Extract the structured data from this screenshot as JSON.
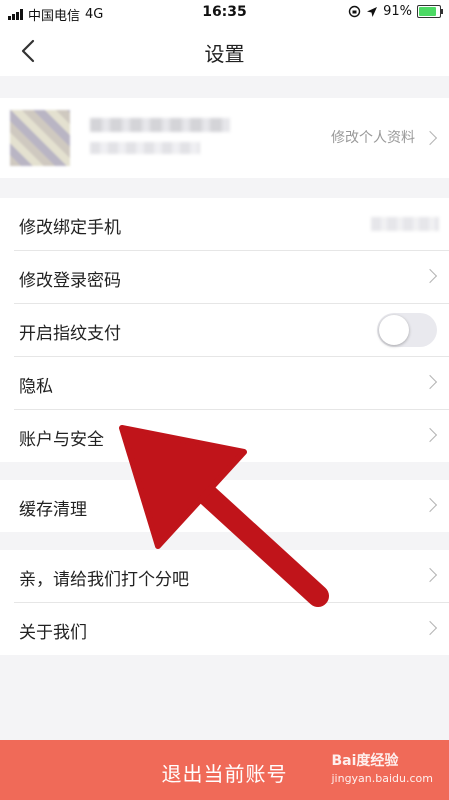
{
  "status_bar": {
    "carrier": "中国电信",
    "network": "4G",
    "time": "16:35",
    "battery": "91%",
    "battery_level": 0.91,
    "colors": {
      "battery_fill": "#4cd964"
    }
  },
  "nav": {
    "title": "设置",
    "back_icon": "chevron-left-icon"
  },
  "profile": {
    "edit_label": "修改个人资料",
    "chevron_icon": "chevron-right-icon"
  },
  "groups": [
    {
      "items": [
        {
          "label": "修改绑定手机",
          "accessory": "blurred-value"
        },
        {
          "label": "修改登录密码",
          "accessory": "chevron"
        },
        {
          "label": "开启指纹支付",
          "accessory": "toggle",
          "toggle_on": false
        },
        {
          "label": "隐私",
          "accessory": "chevron"
        },
        {
          "label": "账户与安全",
          "accessory": "chevron"
        }
      ]
    },
    {
      "items": [
        {
          "label": "缓存清理",
          "accessory": "chevron"
        }
      ]
    },
    {
      "items": [
        {
          "label": "亲，请给我们打个分吧",
          "accessory": "chevron"
        },
        {
          "label": "关于我们",
          "accessory": "chevron"
        }
      ]
    }
  ],
  "logout": {
    "label": "退出当前账号"
  },
  "watermark": {
    "brand": "Bai度经验",
    "url": "jingyan.baidu.com"
  },
  "colors": {
    "logout_bg": "#f06a58",
    "annotation_arrow": "#c0141a",
    "page_bg": "#f4f4f6"
  }
}
